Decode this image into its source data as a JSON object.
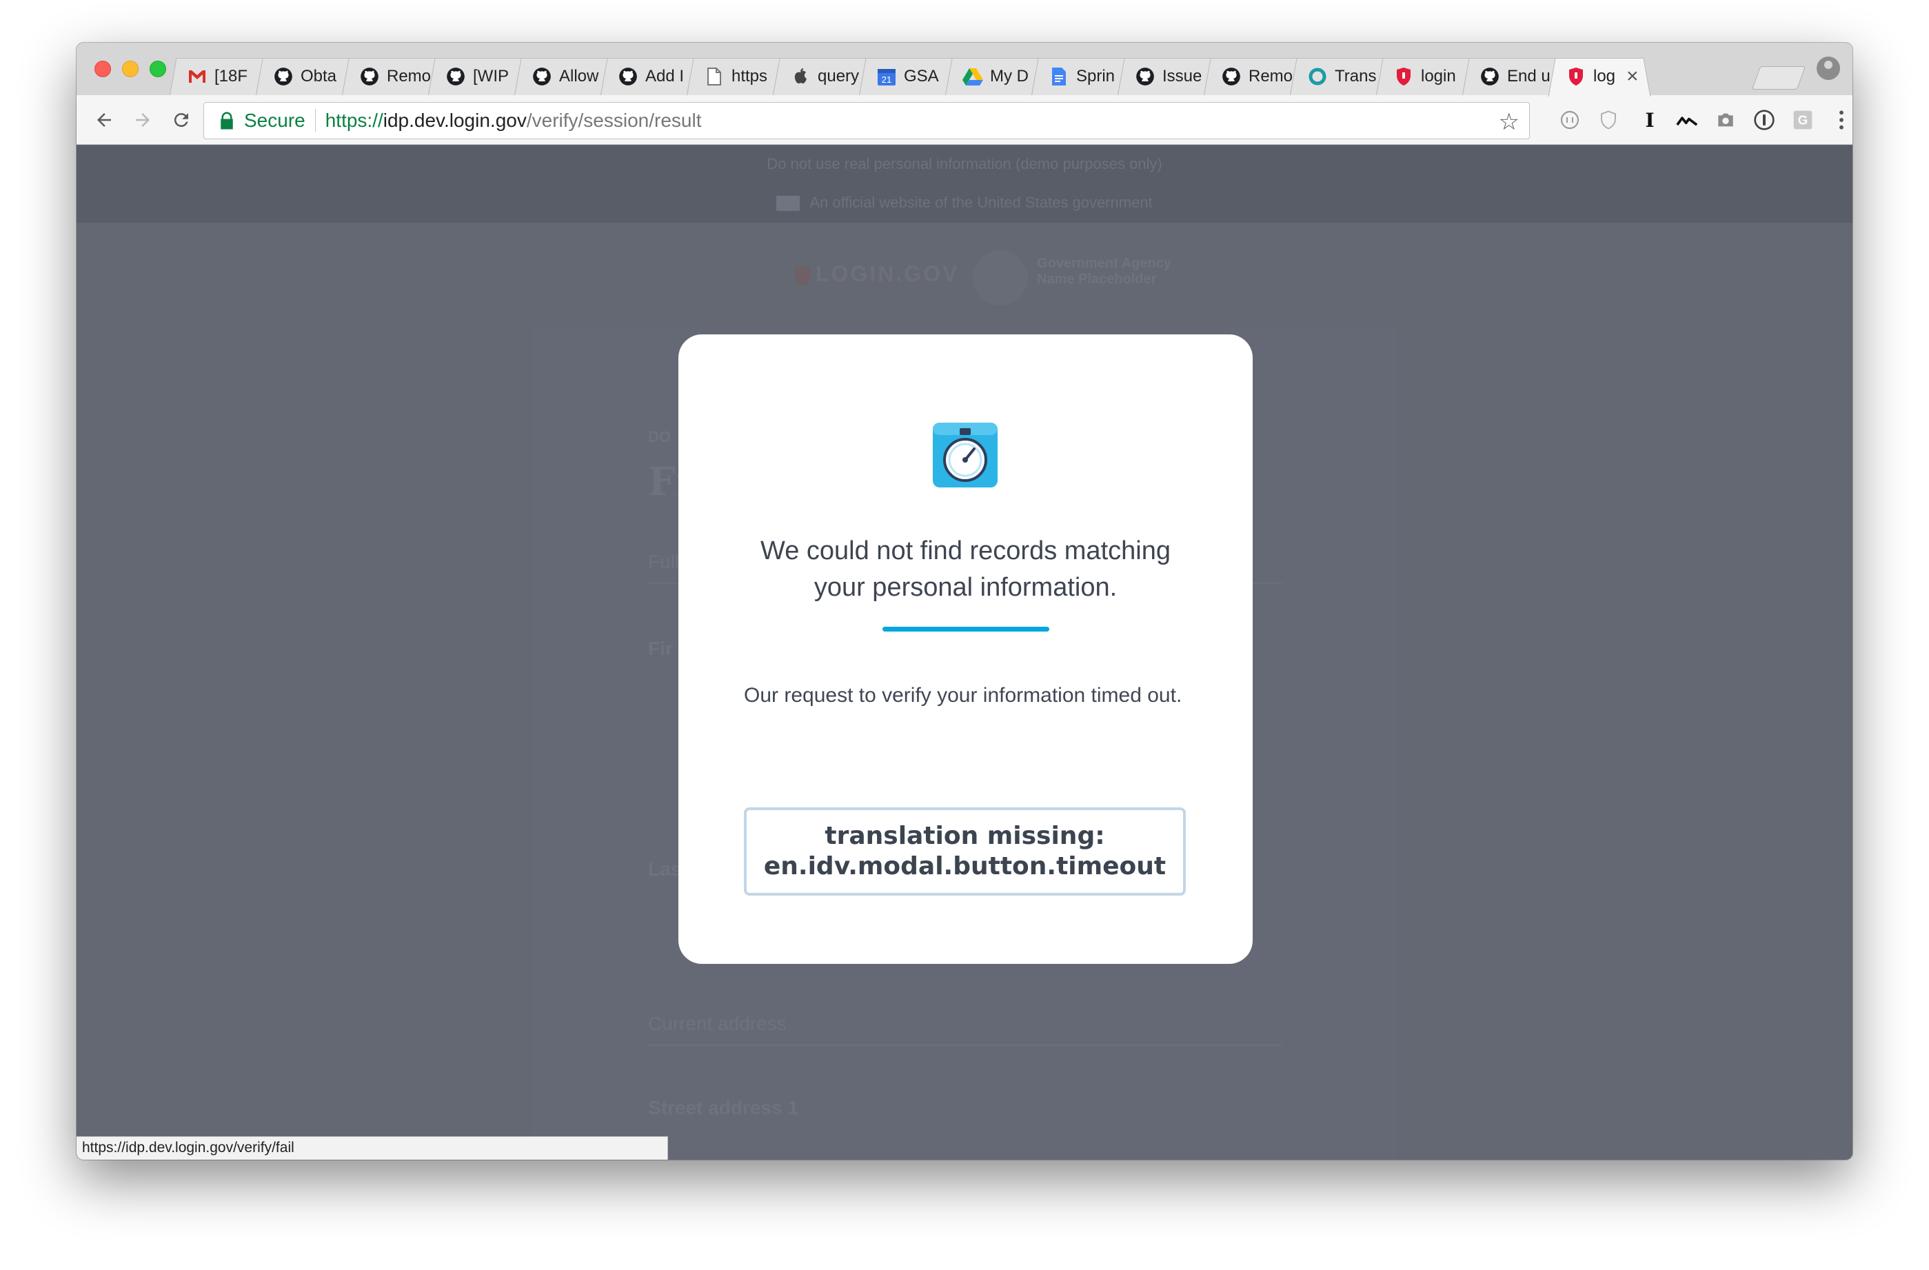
{
  "browser": {
    "tabs": [
      {
        "label": "[18F",
        "icon": "gmail-icon"
      },
      {
        "label": "Obta",
        "icon": "github-icon"
      },
      {
        "label": "Remo",
        "icon": "github-icon"
      },
      {
        "label": "[WIP",
        "icon": "github-icon"
      },
      {
        "label": "Allow",
        "icon": "github-icon"
      },
      {
        "label": "Add I",
        "icon": "github-icon"
      },
      {
        "label": "https",
        "icon": "document-icon"
      },
      {
        "label": "query",
        "icon": "apple-icon"
      },
      {
        "label": "GSA",
        "icon": "calendar-icon",
        "calendar_day": "21"
      },
      {
        "label": "My D",
        "icon": "drive-icon"
      },
      {
        "label": "Sprin",
        "icon": "docs-icon"
      },
      {
        "label": "Issue",
        "icon": "github-icon"
      },
      {
        "label": "Remo",
        "icon": "github-icon"
      },
      {
        "label": "Trans",
        "icon": "ring-icon"
      },
      {
        "label": "login",
        "icon": "login-shield-icon"
      },
      {
        "label": "End u",
        "icon": "github-icon"
      },
      {
        "label": "log",
        "icon": "login-shield-icon",
        "active": true
      }
    ],
    "toolbar": {
      "secure_label": "Secure",
      "url_scheme": "https://",
      "url_host": "idp.dev.login.gov",
      "url_path": "/verify/session/result"
    },
    "status_url": "https://idp.dev.login.gov/verify/fail"
  },
  "page": {
    "banner_demo": "Do not use real personal information (demo purposes only)",
    "banner_official": "An official website of the United States government",
    "logo_text": "LOGIN.GOV",
    "agency_name": "Government Agency Name Placeholder",
    "form_labels": {
      "step": "DO",
      "heading": "Fi",
      "full_name": "Full",
      "first_name": "Fir",
      "last_name": "Las",
      "current_address": "Current address",
      "street_address": "Street address 1"
    }
  },
  "modal": {
    "title": "We could not find records matching your personal information.",
    "body": "Our request to verify your information timed out.",
    "button_label": "translation missing: en.idv.modal.button.timeout",
    "accent_color": "#02a6e0"
  }
}
